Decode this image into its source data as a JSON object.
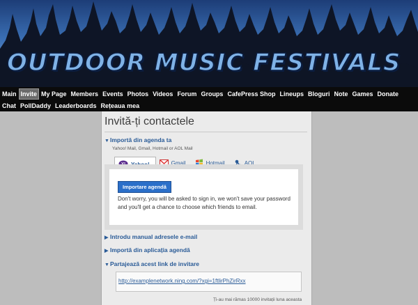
{
  "site": {
    "title": "OUTDOOR MUSIC FESTIVALS"
  },
  "nav": {
    "row1": [
      "Main",
      "Invite",
      "My Page",
      "Members",
      "Events",
      "Photos",
      "Videos",
      "Forum",
      "Groups",
      "CafePress Shop",
      "Lineups",
      "Bloguri",
      "Note",
      "Games",
      "Donate"
    ],
    "row2": [
      "Chat",
      "PollDaddy",
      "Leaderboards",
      "Rețeaua mea"
    ],
    "active": "Invite"
  },
  "page": {
    "title": "Invită-ți contactele",
    "import_section": {
      "label": "Importă din agenda ta",
      "caption": "Yahoo! Mail, Gmail, Hotmail or AOL Mail",
      "tabs": [
        {
          "label": "Yahoo!",
          "icon": "yahoo-icon"
        },
        {
          "label": "Gmail",
          "icon": "gmail-icon"
        },
        {
          "label": "Hotmail",
          "icon": "hotmail-icon"
        },
        {
          "label": "AOL",
          "icon": "aol-icon"
        }
      ],
      "selected_tab": "Yahoo!",
      "button": "Importare agendă",
      "note": "Don't worry, you will be asked to sign in, we won't save your password and you'll get a chance to choose which friends to email."
    },
    "sections": [
      "Introdu manual adresele e-mail",
      "Importă din aplicația agendă",
      "Partajează acest link de invitare"
    ],
    "invite_link": "http://examplenetwork.ning.com/?xgi=1ftlirPhZirRxx",
    "footer_note": "Ți-au mai rămas 10000 invitații luna aceasta"
  },
  "colors": {
    "link": "#2a5b97",
    "button": "#2b6fc9",
    "nav_bg": "#0b0b0b"
  }
}
